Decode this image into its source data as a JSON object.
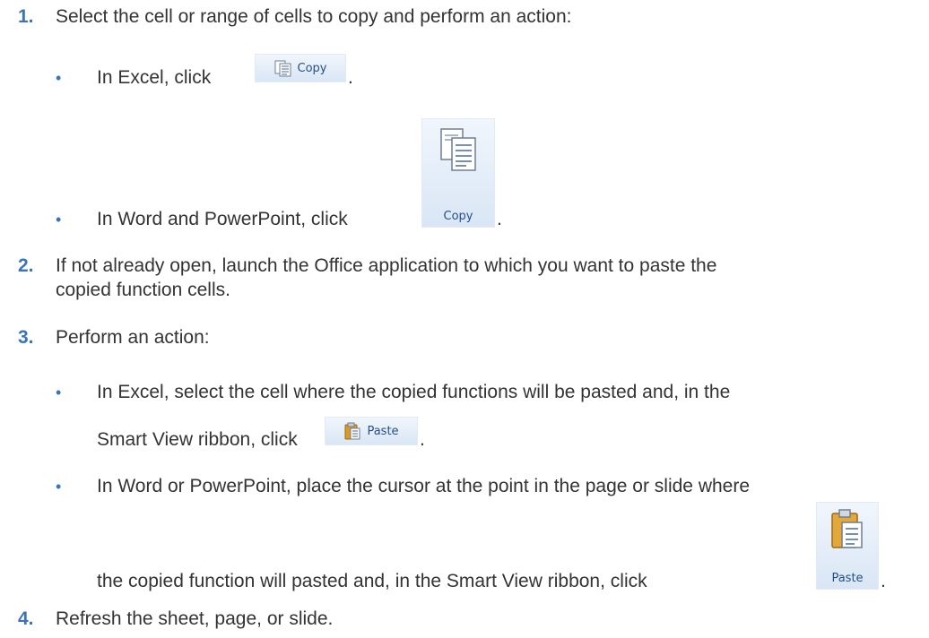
{
  "steps": [
    {
      "number": "1.",
      "text": "Select the cell or range of cells to copy and perform an action:",
      "bullets": [
        {
          "before": "In Excel, click",
          "icon": "copy-icon",
          "button_label": "Copy",
          "after": "."
        },
        {
          "before": "In Word and PowerPoint, click",
          "icon": "copy-icon",
          "button_label": "Copy",
          "after": "."
        }
      ]
    },
    {
      "number": "2.",
      "line1": "If not already open, launch the Office application to which you want to paste the",
      "line2": "copied function cells."
    },
    {
      "number": "3.",
      "text": "Perform an action:",
      "bullets": [
        {
          "line1": "In Excel, select the cell where the copied functions will be pasted and, in the",
          "line2_before": "Smart View ribbon, click",
          "icon": "paste-icon",
          "button_label": "Paste",
          "after": "."
        },
        {
          "line1": "In Word or PowerPoint, place the cursor at the point in the page or slide where",
          "line2_before": "the copied function will pasted and, in the Smart View ribbon, click",
          "icon": "paste-icon",
          "button_label": "Paste",
          "after": "."
        }
      ]
    },
    {
      "number": "4.",
      "text": "Refresh the sheet, page, or slide."
    }
  ],
  "bullet_glyph": "•"
}
